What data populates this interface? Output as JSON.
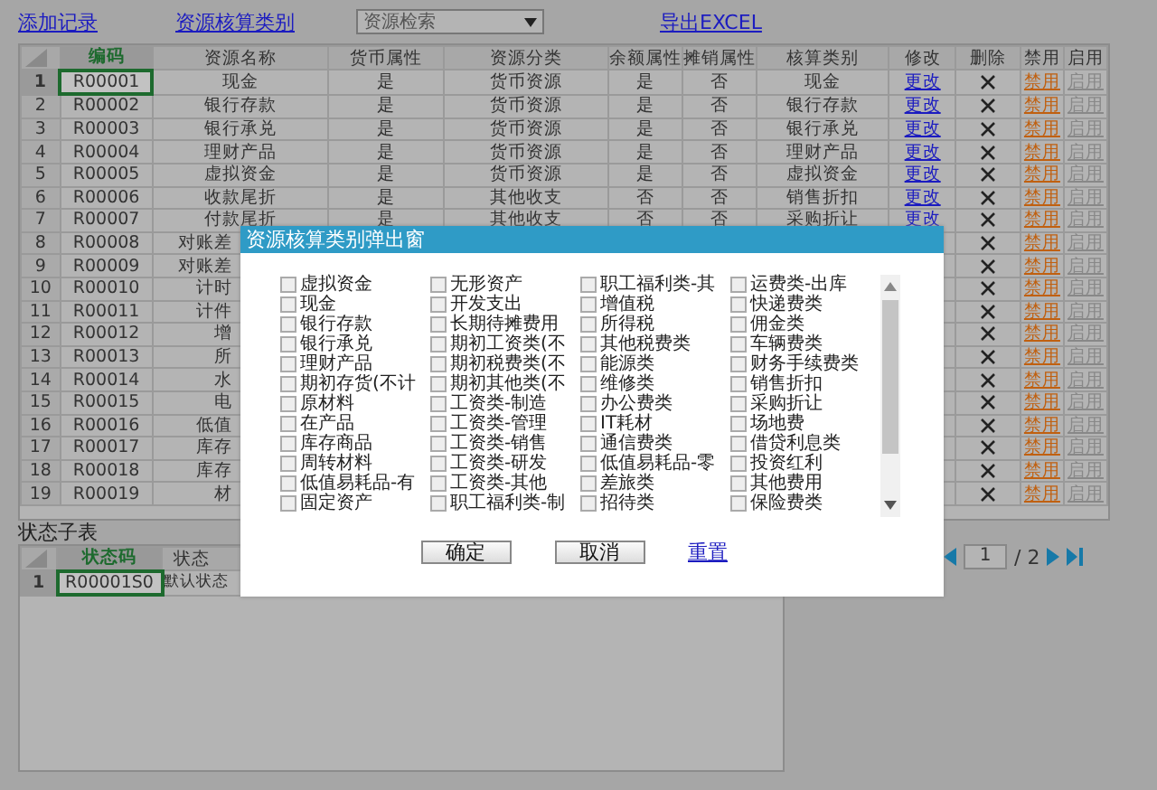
{
  "toolbar": {
    "add_link": "添加记录",
    "category_link": "资源核算类别",
    "search_select": {
      "placeholder": "资源检索"
    },
    "export_link": "导出EXCEL"
  },
  "table": {
    "columns": [
      {
        "label": "编码",
        "selected": true
      },
      {
        "label": "资源名称",
        "selected": false
      },
      {
        "label": "货币属性",
        "selected": false
      },
      {
        "label": "资源分类",
        "selected": false
      },
      {
        "label": "余额属性",
        "selected": false
      },
      {
        "label": "摊销属性",
        "selected": false
      },
      {
        "label": "核算类别",
        "selected": false
      },
      {
        "label": "修改",
        "selected": false
      },
      {
        "label": "删除",
        "selected": false
      },
      {
        "label": "禁用",
        "selected": false
      },
      {
        "label": "启用",
        "selected": false
      }
    ],
    "rows": [
      {
        "kind": "full",
        "selected": true,
        "number": "1",
        "code": "R00001",
        "name": "现金",
        "currency": "是",
        "category": "货币资源",
        "balance": "是",
        "amortize": "否",
        "accounting": "现金",
        "edit": "更改",
        "disable": "禁用",
        "enable": "启用"
      },
      {
        "kind": "full",
        "selected": false,
        "number": "2",
        "code": "R00002",
        "name": "银行存款",
        "currency": "是",
        "category": "货币资源",
        "balance": "是",
        "amortize": "否",
        "accounting": "银行存款",
        "edit": "更改",
        "disable": "禁用",
        "enable": "启用"
      },
      {
        "kind": "full",
        "selected": false,
        "number": "3",
        "code": "R00003",
        "name": "银行承兑",
        "currency": "是",
        "category": "货币资源",
        "balance": "是",
        "amortize": "否",
        "accounting": "银行承兑",
        "edit": "更改",
        "disable": "禁用",
        "enable": "启用"
      },
      {
        "kind": "full",
        "selected": false,
        "number": "4",
        "code": "R00004",
        "name": "理财产品",
        "currency": "是",
        "category": "货币资源",
        "balance": "是",
        "amortize": "否",
        "accounting": "理财产品",
        "edit": "更改",
        "disable": "禁用",
        "enable": "启用"
      },
      {
        "kind": "full",
        "selected": false,
        "number": "5",
        "code": "R00005",
        "name": "虚拟资金",
        "currency": "是",
        "category": "货币资源",
        "balance": "是",
        "amortize": "否",
        "accounting": "虚拟资金",
        "edit": "更改",
        "disable": "禁用",
        "enable": "启用"
      },
      {
        "kind": "full",
        "selected": false,
        "number": "6",
        "code": "R00006",
        "name": "收款尾折",
        "currency": "是",
        "category": "其他收支",
        "balance": "否",
        "amortize": "否",
        "accounting": "销售折扣",
        "edit": "更改",
        "disable": "禁用",
        "enable": "启用"
      },
      {
        "kind": "full",
        "selected": false,
        "number": "7",
        "code": "R00007",
        "name": "付款尾折",
        "currency": "是",
        "category": "其他收支",
        "balance": "否",
        "amortize": "否",
        "accounting": "采购折让",
        "edit": "更改",
        "disable": "禁用",
        "enable": "启用"
      },
      {
        "kind": "partial",
        "selected": false,
        "number": "8",
        "code": "R00008",
        "name": "对账差",
        "disable": "禁用",
        "enable": "启用"
      },
      {
        "kind": "partial",
        "selected": false,
        "number": "9",
        "code": "R00009",
        "name": "对账差",
        "disable": "禁用",
        "enable": "启用"
      },
      {
        "kind": "partial",
        "selected": false,
        "number": "10",
        "code": "R00010",
        "name": "计时",
        "disable": "禁用",
        "enable": "启用"
      },
      {
        "kind": "partial",
        "selected": false,
        "number": "11",
        "code": "R00011",
        "name": "计件",
        "disable": "禁用",
        "enable": "启用"
      },
      {
        "kind": "partial",
        "selected": false,
        "number": "12",
        "code": "R00012",
        "name": "增",
        "disable": "禁用",
        "enable": "启用"
      },
      {
        "kind": "partial",
        "selected": false,
        "number": "13",
        "code": "R00013",
        "name": "所",
        "disable": "禁用",
        "enable": "启用"
      },
      {
        "kind": "partial",
        "selected": false,
        "number": "14",
        "code": "R00014",
        "name": "水",
        "disable": "禁用",
        "enable": "启用"
      },
      {
        "kind": "partial",
        "selected": false,
        "number": "15",
        "code": "R00015",
        "name": "电",
        "disable": "禁用",
        "enable": "启用"
      },
      {
        "kind": "partial",
        "selected": false,
        "number": "16",
        "code": "R00016",
        "name": "低值",
        "disable": "禁用",
        "enable": "启用"
      },
      {
        "kind": "partial",
        "selected": false,
        "number": "17",
        "code": "R00017",
        "name": "库存",
        "disable": "禁用",
        "enable": "启用"
      },
      {
        "kind": "partial",
        "selected": false,
        "number": "18",
        "code": "R00018",
        "name": "库存",
        "disable": "禁用",
        "enable": "启用"
      },
      {
        "kind": "partial",
        "selected": false,
        "number": "19",
        "code": "R00019",
        "name": "材",
        "disable": "禁用",
        "enable": "启用"
      }
    ]
  },
  "subtable": {
    "title": "状态子表",
    "columns": [
      {
        "label": "状态码",
        "selected": true
      },
      {
        "label": "状态",
        "selected": false
      }
    ],
    "rows": [
      {
        "selected": true,
        "number": "1",
        "code": "R00001S0",
        "status": "默认状态"
      }
    ]
  },
  "pagination": {
    "page": "1",
    "total": "/ 2"
  },
  "dialog": {
    "title": "资源核算类别弹出窗",
    "options": [
      {
        "label": "虚拟资金",
        "checked": false
      },
      {
        "label": "现金",
        "checked": false
      },
      {
        "label": "银行存款",
        "checked": false
      },
      {
        "label": "银行承兑",
        "checked": false
      },
      {
        "label": "理财产品",
        "checked": false
      },
      {
        "label": "期初存货(不计",
        "checked": false
      },
      {
        "label": "原材料",
        "checked": false
      },
      {
        "label": "在产品",
        "checked": false
      },
      {
        "label": "库存商品",
        "checked": false
      },
      {
        "label": "周转材料",
        "checked": false
      },
      {
        "label": "低值易耗品-有",
        "checked": false
      },
      {
        "label": "固定资产",
        "checked": false
      },
      {
        "label": "无形资产",
        "checked": false
      },
      {
        "label": "开发支出",
        "checked": false
      },
      {
        "label": "长期待摊费用",
        "checked": false
      },
      {
        "label": "期初工资类(不",
        "checked": false
      },
      {
        "label": "期初税费类(不",
        "checked": false
      },
      {
        "label": "期初其他类(不",
        "checked": false
      },
      {
        "label": "工资类-制造",
        "checked": false
      },
      {
        "label": "工资类-管理",
        "checked": false
      },
      {
        "label": "工资类-销售",
        "checked": false
      },
      {
        "label": "工资类-研发",
        "checked": false
      },
      {
        "label": "工资类-其他",
        "checked": false
      },
      {
        "label": "职工福利类-制",
        "checked": false
      },
      {
        "label": "职工福利类-其",
        "checked": false
      },
      {
        "label": "增值税",
        "checked": false
      },
      {
        "label": "所得税",
        "checked": false
      },
      {
        "label": "其他税费类",
        "checked": false
      },
      {
        "label": "能源类",
        "checked": false
      },
      {
        "label": "维修类",
        "checked": false
      },
      {
        "label": "办公费类",
        "checked": false
      },
      {
        "label": "IT耗材",
        "checked": false
      },
      {
        "label": "通信费类",
        "checked": false
      },
      {
        "label": "低值易耗品-零",
        "checked": false
      },
      {
        "label": "差旅类",
        "checked": false
      },
      {
        "label": "招待类",
        "checked": false
      },
      {
        "label": "运费类-出库",
        "checked": false
      },
      {
        "label": "快递费类",
        "checked": false
      },
      {
        "label": "佣金类",
        "checked": false
      },
      {
        "label": "车辆费类",
        "checked": false
      },
      {
        "label": "财务手续费类",
        "checked": false
      },
      {
        "label": "销售折扣",
        "checked": false
      },
      {
        "label": "采购折让",
        "checked": false
      },
      {
        "label": "场地费",
        "checked": false
      },
      {
        "label": "借贷利息类",
        "checked": false
      },
      {
        "label": "投资红利",
        "checked": false
      },
      {
        "label": "其他费用",
        "checked": false
      },
      {
        "label": "保险费类",
        "checked": false
      }
    ],
    "ok_button": "确定",
    "cancel_button": "取消",
    "reset_link": "重置"
  }
}
